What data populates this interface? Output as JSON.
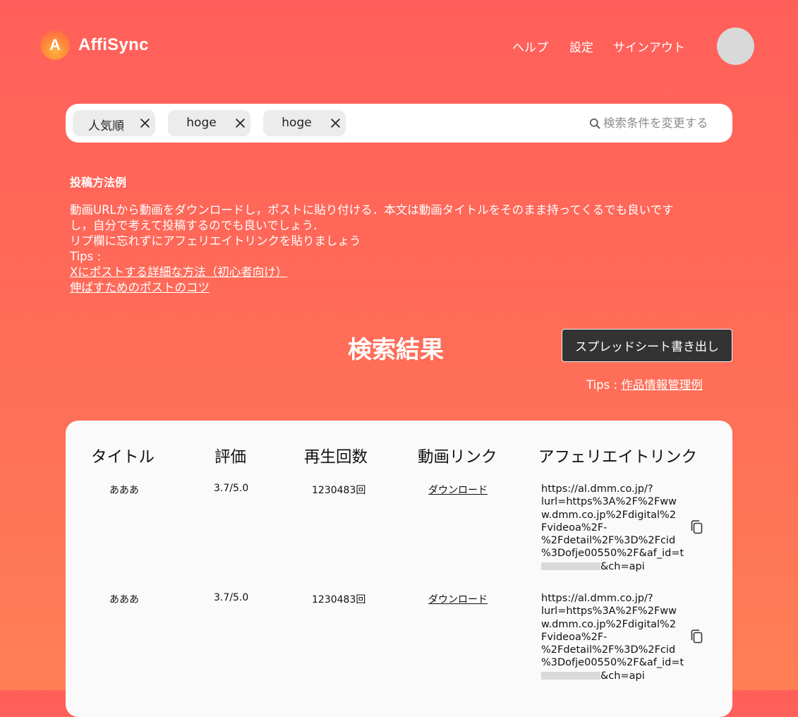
{
  "header": {
    "logo_letter": "A",
    "app_name": "AffiSync",
    "nav": {
      "help": "ヘルプ",
      "settings": "設定",
      "signout": "サインアウト"
    }
  },
  "search": {
    "chips": [
      {
        "label": "人気順"
      },
      {
        "label": "hoge"
      },
      {
        "label": "hoge"
      }
    ],
    "placeholder": "検索条件を変更する",
    "icon": "search-icon"
  },
  "post_example": {
    "title": "投稿方法例",
    "line1": "動画URLから動画をダウンロードし，ポストに貼り付ける．本文は動画タイトルをそのまま持ってくるでも良いです",
    "line2": "し，自分で考えて投稿するのでも良いでしょう．",
    "line3": "リプ欄に忘れずにアフェリエイトリンクを貼りましょう",
    "tips_label": "Tips :",
    "link1": "Xにポストする詳細な方法（初心者向け）",
    "link2": "伸ばすためのポストのコツ"
  },
  "results": {
    "title": "検索結果",
    "export_button": "スプレッドシート書き出し",
    "tips_prefix": "Tips : ",
    "tips_link": "作品情報管理例"
  },
  "table": {
    "headers": {
      "title": "タイトル",
      "rating": "評価",
      "plays": "再生回数",
      "video_link": "動画リンク",
      "affiliate_link": "アフェリエイトリンク"
    },
    "rows": [
      {
        "title": "あああ",
        "rating": "3.7/5.0",
        "plays": "1230483回",
        "video_link": "ダウンロード",
        "url_lines": [
          "https://al.dmm.co.jp/?",
          "lurl=https%3A%2F%2Fww",
          "w.dmm.co.jp%2Fdigital%2",
          "Fvideoa%2F-",
          "%2Fdetail%2F%3D%2Fcid",
          "%3Dofje00550%2F&af_id=t"
        ],
        "url_tail": "&ch=api"
      },
      {
        "title": "あああ",
        "rating": "3.7/5.0",
        "plays": "1230483回",
        "video_link": "ダウンロード",
        "url_lines": [
          "https://al.dmm.co.jp/?",
          "lurl=https%3A%2F%2Fww",
          "w.dmm.co.jp%2Fdigital%2",
          "Fvideoa%2F-",
          "%2Fdetail%2F%3D%2Fcid",
          "%3Dofje00550%2F&af_id=t"
        ],
        "url_tail": "&ch=api"
      }
    ],
    "copy_icon": "copy-icon"
  },
  "colors": {
    "background_top": "#ff5f5a",
    "background_bottom": "#ff7f55",
    "button_dark": "#333333",
    "chip_bg": "#ececec",
    "avatar": "#d9d9d9"
  }
}
